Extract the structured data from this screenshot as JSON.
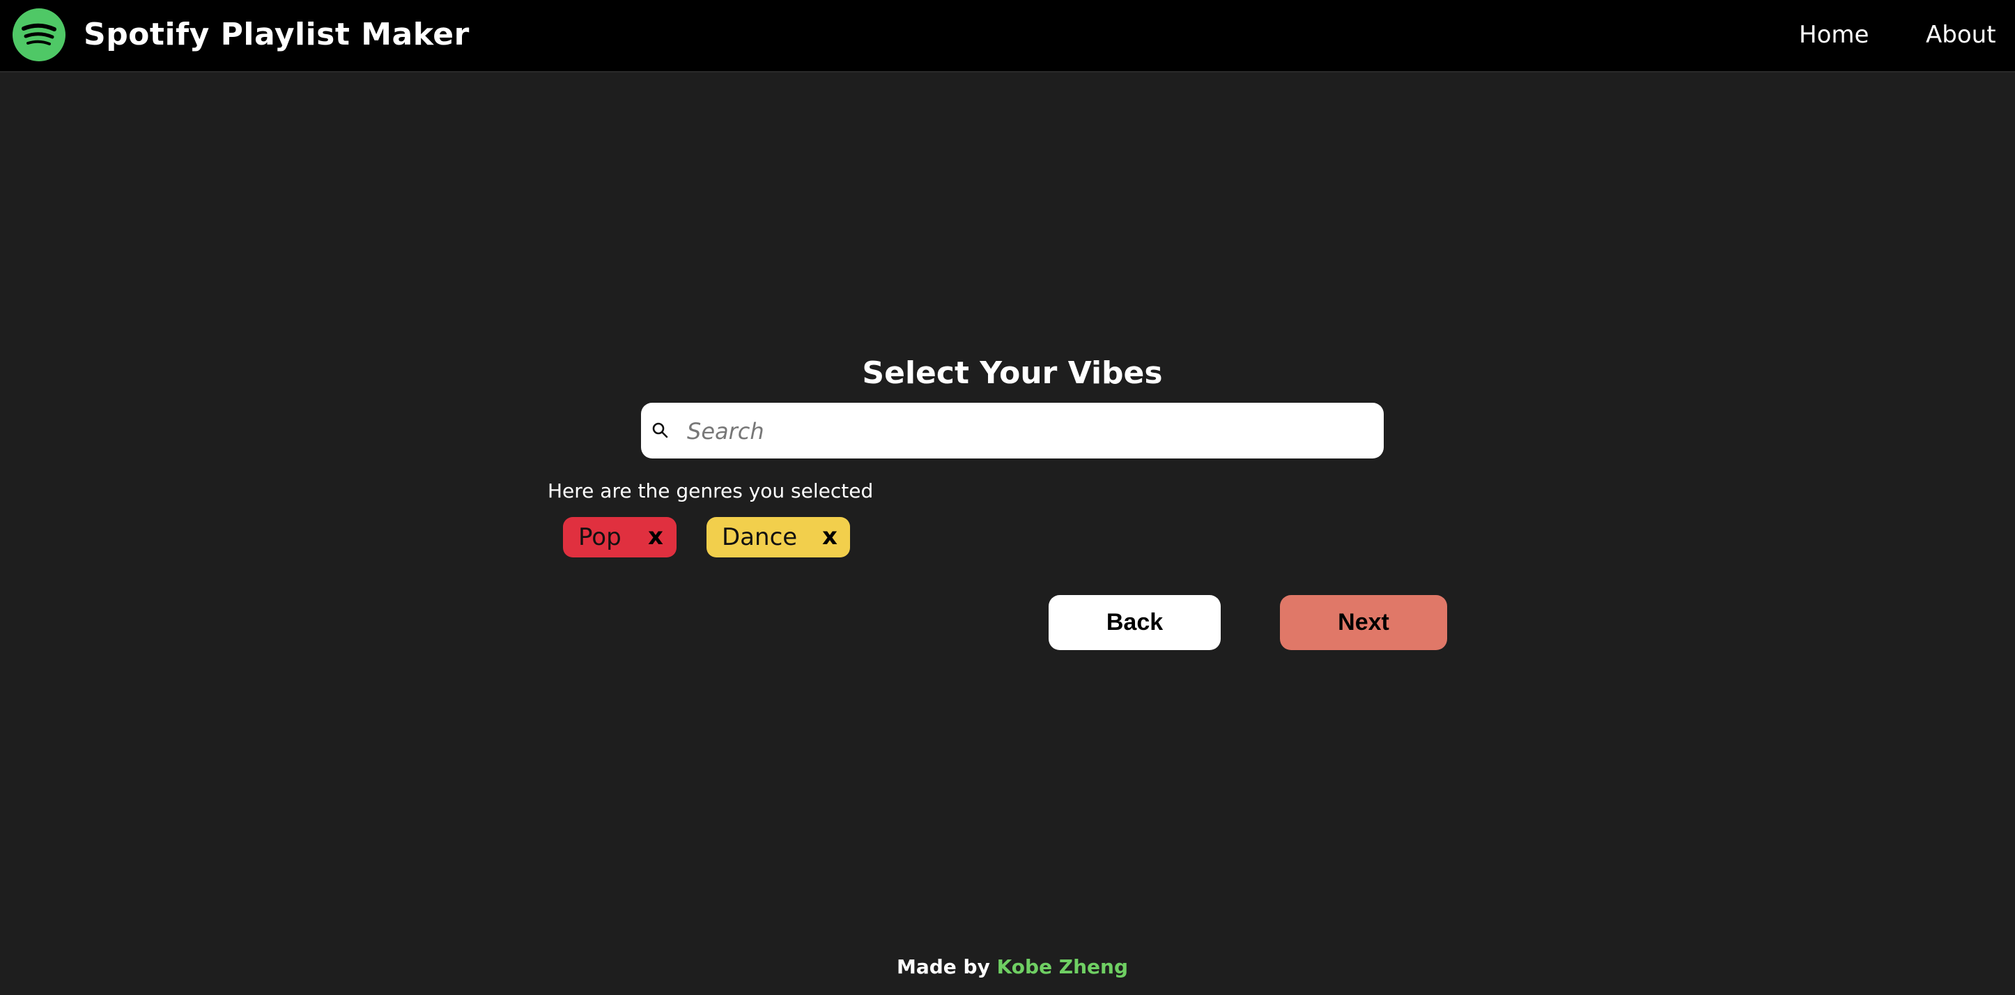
{
  "navbar": {
    "brand": "Spotify Playlist Maker",
    "logo_icon": "spotify-icon",
    "links": [
      "Home",
      "About"
    ]
  },
  "main": {
    "title": "Select Your Vibes",
    "search": {
      "placeholder": "Search",
      "value": "",
      "icon": "search-icon"
    },
    "selected_label": "Here are the genres you selected",
    "genres": [
      {
        "label": "Pop",
        "remove": "x",
        "color": "#e0303f"
      },
      {
        "label": "Dance",
        "remove": "x",
        "color": "#f2cf4c"
      }
    ],
    "buttons": {
      "back": "Back",
      "next": "Next"
    }
  },
  "footer": {
    "prefix": "Made by",
    "author": "Kobe Zheng"
  },
  "colors": {
    "background": "#1e1e1e",
    "navbar": "#000000",
    "brand_green": "#4fc866",
    "next_button": "#e07868",
    "author_link": "#6fcf63"
  }
}
